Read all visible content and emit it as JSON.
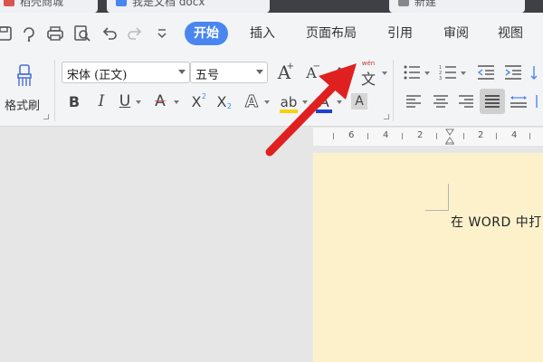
{
  "tabs": [
    {
      "label": "稻壳商城",
      "icon_color": "#d9534f"
    },
    {
      "label": "我是文档 docx",
      "icon_color": "#4a86f0"
    },
    {
      "label": "新建",
      "icon_color": "#888888"
    }
  ],
  "quick_access": [
    {
      "icon": "save-icon"
    },
    {
      "icon": "undo-history-icon"
    },
    {
      "icon": "print-icon"
    },
    {
      "icon": "print-preview-icon"
    },
    {
      "icon": "undo-icon"
    },
    {
      "icon": "redo-icon"
    },
    {
      "icon": "more-dropdown-icon"
    }
  ],
  "menu": {
    "items": [
      "开始",
      "插入",
      "页面布局",
      "引用",
      "审阅",
      "视图"
    ],
    "active_index": 0
  },
  "ribbon": {
    "format_painter_label": "格式刷",
    "font_name": "宋体 (正文)",
    "font_size": "五号",
    "grow_font_glyph": "A",
    "shrink_font_glyph": "A",
    "bold_glyph": "B",
    "italic_glyph": "I",
    "underline_glyph": "U",
    "strike_glyph": "A",
    "superscript_glyph": "X",
    "subscript_glyph": "X",
    "text_effect_glyph": "A",
    "highlight_glyph": "ab",
    "font_color_glyph": "A",
    "char_shading_glyph": "A",
    "phonetic_glyph": "文",
    "phonetic_top": "wén",
    "highlight_color": "#f5d400",
    "font_color": "#1e3fd6",
    "strike_color": "#d9534f"
  },
  "ruler": {
    "labels": [
      "6",
      "4",
      "2",
      "2",
      "4",
      "6"
    ]
  },
  "document": {
    "text": "在 WORD 中打"
  },
  "colors": {
    "accent": "#4a86f0",
    "page_bg": "#fdf1cc",
    "arrow": "#e02020"
  }
}
